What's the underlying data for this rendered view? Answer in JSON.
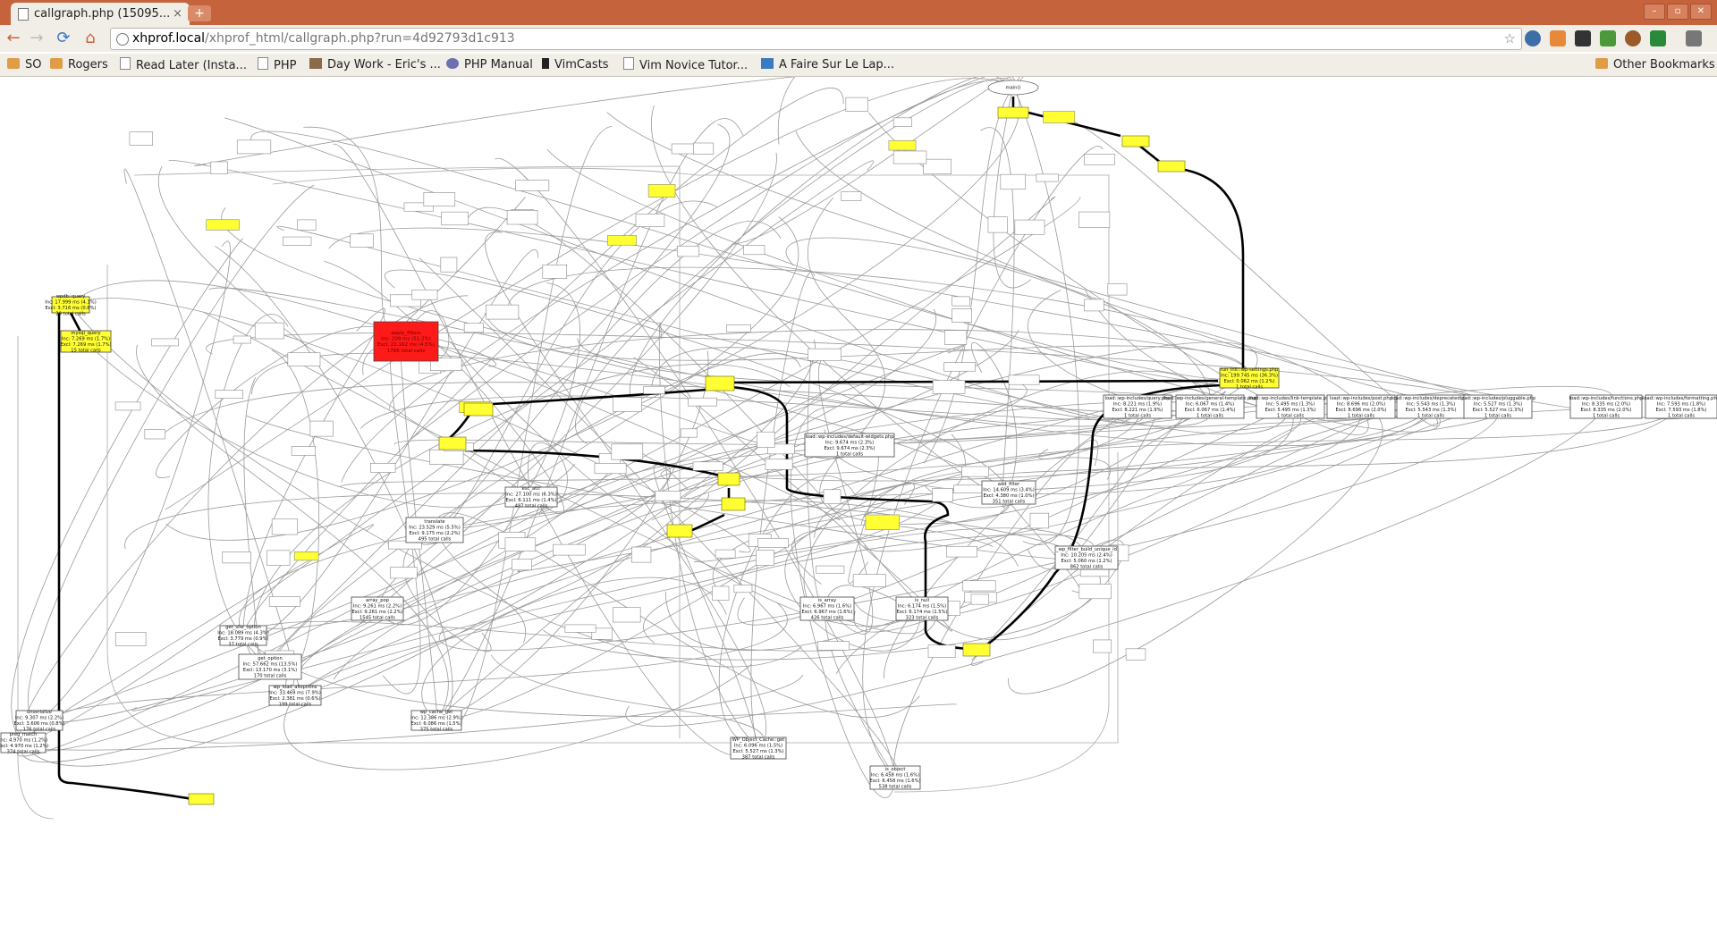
{
  "tab": {
    "title": "callgraph.php (15095...",
    "close": "×"
  },
  "new_tab": "+",
  "window_buttons": {
    "minimize": "–",
    "maximize": "▫",
    "close": "✕"
  },
  "nav": {
    "back": "←",
    "forward": "→",
    "reload": "⟳",
    "home": "⌂"
  },
  "address": {
    "host": "xhprof.local",
    "path": "/xhprof_html/callgraph.php?run=4d92793d1c913",
    "star": "☆"
  },
  "bookmarks": [
    {
      "label": "SO"
    },
    {
      "label": "Rogers"
    },
    {
      "label": "Read Later (Insta..."
    },
    {
      "label": "PHP"
    },
    {
      "label": "Day Work - Eric's ..."
    },
    {
      "label": "PHP Manual"
    },
    {
      "label": "VimCasts"
    },
    {
      "label": "Vim Novice Tutor..."
    },
    {
      "label": "A Faire Sur Le Lap..."
    }
  ],
  "other_bookmarks": "Other Bookmarks",
  "colors": {
    "hot": "#ff1a1a",
    "warm": "#ffff33",
    "titlebar": "#c5643c"
  },
  "graph": {
    "nodes": [
      {
        "id": "main",
        "lines": [
          "main()"
        ],
        "color": "white"
      },
      {
        "id": "run_init",
        "lines": [
          "run_init::wp-settings.php",
          "Inc: 199.745 ms (36.3%)",
          "Excl: 0.062 ms (1.2%)",
          "1 total calls"
        ],
        "color": "yellow"
      },
      {
        "id": "apply_filters",
        "lines": [
          "apply_filters",
          "Inc: 209 ms (51.2%)",
          "Excl: 22.162 ms (4.5%)",
          "1786 total calls"
        ],
        "color": "red"
      },
      {
        "id": "wpdb_query",
        "lines": [
          "wpdb::query",
          "Inc: 17.999 ms (4.1%)",
          "Excl: 3.716 ms (0.8%)",
          "29 total calls"
        ],
        "color": "yellow"
      },
      {
        "id": "mysql_query",
        "lines": [
          "mysql_query",
          "Inc: 7.269 ms (1.7%)",
          "Excl: 7.269 ms (1.7%)",
          "15 total calls"
        ],
        "color": "yellow"
      },
      {
        "id": "load_widgets",
        "lines": [
          "load::wp-includes/default-widgets.php",
          "Inc: 9.674 ms (2.3%)",
          "Excl: 9.674 ms (2.3%)",
          "1 total calls"
        ],
        "color": "white"
      },
      {
        "id": "translate",
        "lines": [
          "translate",
          "Inc: 23.529 ms (5.5%)",
          "Excl: 9.175 ms (2.2%)",
          "495 total calls"
        ],
        "color": "white"
      },
      {
        "id": "get_option",
        "lines": [
          "get_option",
          "Inc: 57.662 ms (13.5%)",
          "Excl: 13.170 ms (3.1%)",
          "170 total calls"
        ],
        "color": "white"
      },
      {
        "id": "array_pop",
        "lines": [
          "array_pop",
          "Inc: 9.261 ms (2.2%)",
          "Excl: 9.261 ms (2.2%)",
          "1545 total calls"
        ],
        "color": "white"
      },
      {
        "id": "is_array",
        "lines": [
          "is_array",
          "Inc: 6.967 ms (1.6%)",
          "Excl: 6.967 ms (1.6%)",
          "426 total calls"
        ],
        "color": "white"
      },
      {
        "id": "in_null",
        "lines": [
          "is_null",
          "Inc: 6.174 ms (1.5%)",
          "Excl: 6.174 ms (1.5%)",
          "323 total calls"
        ],
        "color": "white"
      },
      {
        "id": "wp_cache_get",
        "lines": [
          "wp_cache_get",
          "Inc: 12.386 ms (2.9%)",
          "Excl: 6.086 ms (1.5%)",
          "375 total calls"
        ],
        "color": "white"
      },
      {
        "id": "obj_cache_get",
        "lines": [
          "WP_Object_Cache::get",
          "Inc: 6.096 ms (1.5%)",
          "Excl: 5.527 ms (1.3%)",
          "387 total calls"
        ],
        "color": "white"
      },
      {
        "id": "is_object",
        "lines": [
          "is_object",
          "Inc: 6.458 ms (1.6%)",
          "Excl: 6.458 ms (1.6%)",
          "538 total calls"
        ],
        "color": "white"
      },
      {
        "id": "preg_match",
        "lines": [
          "preg_match",
          "Inc: 4.970 ms (1.2%)",
          "Excl: 4.970 ms (1.2%)",
          "374 total calls"
        ],
        "color": "white"
      },
      {
        "id": "load_query",
        "lines": [
          "load::wp-includes/query.php",
          "Inc: 8.221 ms (1.9%)",
          "Excl: 8.221 ms (1.9%)",
          "1 total calls"
        ],
        "color": "white"
      },
      {
        "id": "load_template",
        "lines": [
          "load::wp-includes/general-template.php",
          "Inc: 6.067 ms (1.4%)",
          "Excl: 6.067 ms (1.4%)",
          "1 total calls"
        ],
        "color": "white"
      },
      {
        "id": "load_post_tpl",
        "lines": [
          "load::wp-includes/link-template.php",
          "Inc: 5.495 ms (1.3%)",
          "Excl: 5.495 ms (1.3%)",
          "1 total calls"
        ],
        "color": "white"
      },
      {
        "id": "load_post",
        "lines": [
          "load::wp-includes/post.php",
          "Inc: 8.696 ms (2.0%)",
          "Excl: 8.696 ms (2.0%)",
          "1 total calls"
        ],
        "color": "white"
      },
      {
        "id": "load_depr",
        "lines": [
          "load::wp-includes/deprecated.php",
          "Inc: 5.543 ms (1.3%)",
          "Excl: 5.543 ms (1.3%)",
          "1 total calls"
        ],
        "color": "white"
      },
      {
        "id": "load_plug",
        "lines": [
          "load::wp-includes/pluggable.php",
          "Inc: 5.527 ms (1.3%)",
          "Excl: 5.527 ms (1.3%)",
          "1 total calls"
        ],
        "color": "white"
      },
      {
        "id": "load_functions",
        "lines": [
          "load::wp-includes/functions.php",
          "Inc: 8.335 ms (2.0%)",
          "Excl: 8.335 ms (2.0%)",
          "1 total calls"
        ],
        "color": "white"
      },
      {
        "id": "load_formatting",
        "lines": [
          "load::wp-includes/formatting.php",
          "Inc: 7.593 ms (1.8%)",
          "Excl: 7.593 ms (1.8%)",
          "1 total calls"
        ],
        "color": "white"
      },
      {
        "id": "wp_filter_unique",
        "lines": [
          "_wp_filter_build_unique_id",
          "Inc: 10.205 ms (2.4%)",
          "Excl: 5.060 ms (1.2%)",
          "862 total calls"
        ],
        "color": "white"
      },
      {
        "id": "add_filter",
        "lines": [
          "add_filter",
          "Inc: 14.609 ms (3.4%)",
          "Excl: 4.380 ms (1.0%)",
          "351 total calls"
        ],
        "color": "white"
      },
      {
        "id": "get_site_option",
        "lines": [
          "get_site_option",
          "Inc: 18.089 ms (4.3%)",
          "Excl: 3.779 ms (0.9%)",
          "37 total calls"
        ],
        "color": "white"
      },
      {
        "id": "wp_load_alloptions",
        "lines": [
          "wp_load_alloptions",
          "Inc: 33.469 ms (7.9%)",
          "Excl: 2.381 ms (0.6%)",
          "199 total calls"
        ],
        "color": "white"
      },
      {
        "id": "unserialize",
        "lines": [
          "unserialize",
          "Inc: 9.307 ms (2.2%)",
          "Excl: 3.606 ms (0.8%)",
          "176 total calls"
        ],
        "color": "white"
      },
      {
        "id": "esc_attr",
        "lines": [
          "esc_attr",
          "Inc: 27.100 ms (6.3%)",
          "Excl: 6.111 ms (1.4%)",
          "487 total calls"
        ],
        "color": "white"
      }
    ]
  }
}
